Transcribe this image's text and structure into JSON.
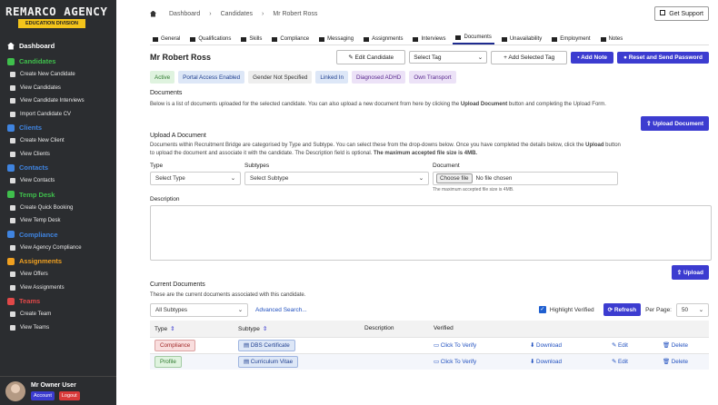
{
  "brand": {
    "title": "REMARCO AGENCY",
    "subtitle": "EDUCATION DIVISION"
  },
  "sidebar": {
    "dashboard": "Dashboard",
    "sections": [
      {
        "label": "Candidates",
        "color": "#3fbf4c",
        "items": [
          "Create New Candidate",
          "View Candidates",
          "View Candidate Interviews",
          "Import Candidate CV"
        ]
      },
      {
        "label": "Clients",
        "color": "#3f84e0",
        "items": [
          "Create New Client",
          "View Clients"
        ]
      },
      {
        "label": "Contacts",
        "color": "#3f84e0",
        "items": [
          "View Contacts"
        ]
      },
      {
        "label": "Temp Desk",
        "color": "#3fbf4c",
        "items": [
          "Create Quick Booking",
          "View Temp Desk"
        ]
      },
      {
        "label": "Compliance",
        "color": "#3f84e0",
        "items": [
          "View Agency Compliance"
        ]
      },
      {
        "label": "Assignments",
        "color": "#f0a020",
        "items": [
          "View Offers",
          "View Assignments"
        ]
      },
      {
        "label": "Teams",
        "color": "#e04848",
        "items": [
          "Create Team",
          "View Teams"
        ]
      }
    ],
    "user": {
      "name": "Mr Owner User",
      "account": "Account",
      "logout": "Logout"
    }
  },
  "topbar": {
    "crumbs": [
      "Dashboard",
      "Candidates",
      "Mr Robert Ross"
    ],
    "support": "Get Support"
  },
  "tabs": [
    "General",
    "Qualifications",
    "Skills",
    "Compliance",
    "Messaging",
    "Assignments",
    "Interviews",
    "Documents",
    "Unavailability",
    "Employment",
    "Notes"
  ],
  "active_tab": "Documents",
  "header": {
    "name": "Mr Robert Ross",
    "edit": "Edit Candidate",
    "select_tag": "Select Tag",
    "add_tag": "Add Selected Tag",
    "add_note": "Add Note",
    "reset": "Reset and Send Password"
  },
  "badges": [
    {
      "label": "Active",
      "bg": "#dff3df",
      "fg": "#2f7a2f"
    },
    {
      "label": "Portal Access Enabled",
      "bg": "#dde7f7",
      "fg": "#1f3f8f"
    },
    {
      "label": "Gender Not Specified",
      "bg": "#eeeeee",
      "fg": "#333333"
    },
    {
      "label": "Linked In",
      "bg": "#dde7f7",
      "fg": "#1f3f8f"
    },
    {
      "label": "Diagnosed ADHD",
      "bg": "#ece2f7",
      "fg": "#5a2a8f"
    },
    {
      "label": "Own Transport",
      "bg": "#ece2f7",
      "fg": "#5a2a8f"
    }
  ],
  "documents": {
    "heading": "Documents",
    "desc_pre": "Below is a list of documents uploaded for the selected candidate. You can also upload a new document from here by clicking the ",
    "desc_bold": "Upload Document",
    "desc_post": " button and completing the Upload Form.",
    "upload_btn": "Upload Document"
  },
  "upload": {
    "heading": "Upload A Document",
    "desc1": "Documents within Recruitment Bridge are categorised by Type and Subtype. You can select these from the drop-downs below. Once you have completed the details below, click the ",
    "desc1_bold": "Upload",
    "desc1_post": " button",
    "desc2": "to upload the document and associate it with the candidate. The Description field is optional. ",
    "desc2_bold": "The maximum accepted file size is 4MB.",
    "type_label": "Type",
    "type_value": "Select Type",
    "subtype_label": "Subtypes",
    "subtype_value": "Select Subtype",
    "doc_label": "Document",
    "choose": "Choose file",
    "nofile": "No file chosen",
    "hint": "The maximum accepted file size is 4MB.",
    "desc_label": "Description",
    "upload": "Upload"
  },
  "current": {
    "heading": "Current Documents",
    "desc": "These are the current documents associated with this candidate.",
    "filter": "All Subtypes",
    "advanced": "Advanced Search...",
    "highlight": "Highlight Verified",
    "refresh": "Refresh",
    "per_page_label": "Per Page:",
    "per_page": "50",
    "columns": [
      "Type",
      "Subtype",
      "Description",
      "Verified"
    ],
    "rows": [
      {
        "type": "Compliance",
        "type_bg": "#f9dede",
        "type_fg": "#a02828",
        "subtype": "DBS Certificate",
        "description": "",
        "verify": "Click To Verify",
        "download": "Download",
        "edit": "Edit",
        "delete": "Delete"
      },
      {
        "type": "Profile",
        "type_bg": "#dff3df",
        "type_fg": "#2f7a2f",
        "subtype": "Curriculum Vitae",
        "description": "",
        "verify": "Click To Verify",
        "download": "Download",
        "edit": "Edit",
        "delete": "Delete"
      }
    ]
  },
  "colors": {
    "primary": "#3c3cd0",
    "sidebar_bg": "#2b2d30",
    "accent_yellow": "#f3c41b"
  }
}
